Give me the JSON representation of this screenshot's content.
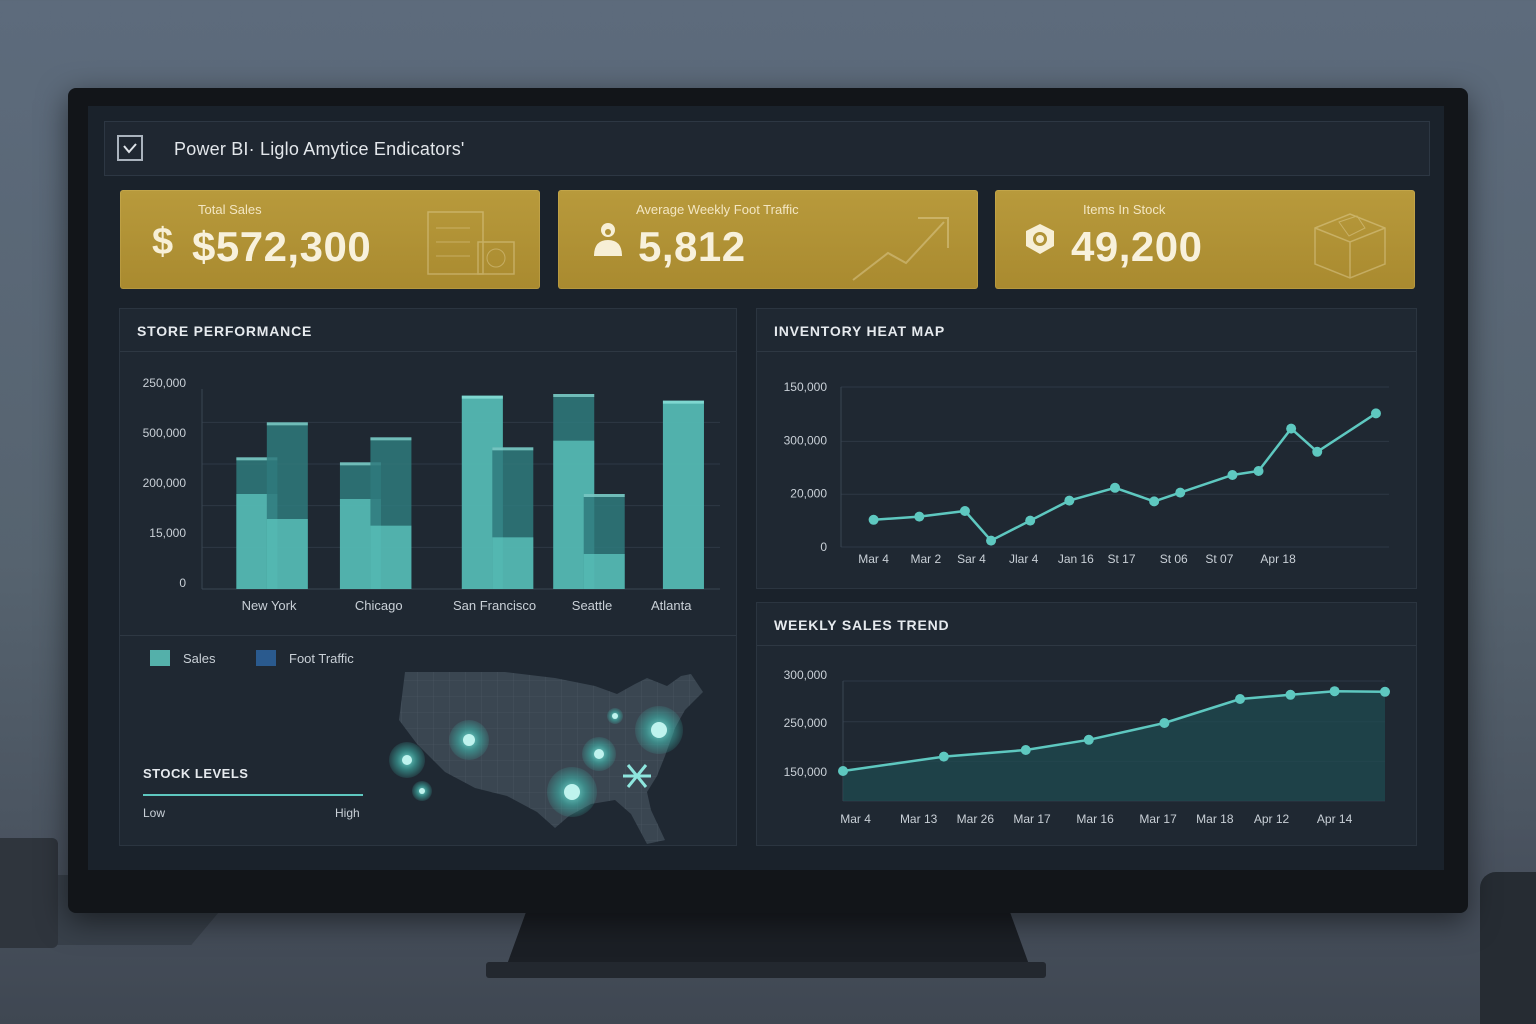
{
  "app": {
    "title": "Power BI· Liglo Amytice Endicators'"
  },
  "kpis": [
    {
      "label": "Total Sales",
      "value": "$572,300",
      "icon": "dollar-icon"
    },
    {
      "label": "Average Weekly Foot Traffic",
      "value": "5,812",
      "icon": "people-icon"
    },
    {
      "label": "Items In Stock",
      "value": "49,200",
      "icon": "stock-badge-icon"
    }
  ],
  "store_performance": {
    "title": "STORE PERFORMANCE",
    "legend": {
      "sales": "Sales",
      "foot_traffic": "Foot Traffic"
    },
    "stock_levels": {
      "title": "STOCK LEVELS",
      "low": "Low",
      "high": "High"
    }
  },
  "inventory_heat_map": {
    "title": "INVENTORY HEAT MAP"
  },
  "weekly_sales_trend": {
    "title": "WEEKLY SALES TREND"
  },
  "colors": {
    "accent": "#5ec8c0",
    "kpi_gold": "#b3953a",
    "panel": "#1f2832",
    "foot_traffic_legend": "#2a5a8e"
  },
  "chart_data": [
    {
      "type": "bar",
      "title": "STORE PERFORMANCE",
      "y_tick_labels": [
        "250,000",
        "500,000",
        "200,000",
        "15,000",
        "0"
      ],
      "categories": [
        "New York",
        "Chicago",
        "San Francisco",
        "Seattle",
        "Atlanta"
      ],
      "bars": [
        {
          "position": 0.9,
          "back": 0.79,
          "front": 0.57
        },
        {
          "position": 1.4,
          "back": 1.0,
          "front": 0.42
        },
        {
          "position": 2.6,
          "back": 0.76,
          "front": 0.54
        },
        {
          "position": 3.1,
          "back": 0.91,
          "front": 0.38
        },
        {
          "position": 4.6,
          "back": 1.16,
          "front": 1.16
        },
        {
          "position": 5.1,
          "back": 0.85,
          "front": 0.31
        },
        {
          "position": 6.1,
          "back": 1.17,
          "front": 0.89
        },
        {
          "position": 6.6,
          "back": 0.57,
          "front": 0.21
        },
        {
          "position": 7.9,
          "back": 1.13,
          "front": 1.13
        }
      ],
      "category_positions": [
        1.1,
        2.9,
        4.8,
        6.4,
        7.7
      ],
      "xlim": [
        0,
        8.5
      ],
      "legend": [
        "Sales",
        "Foot Traffic"
      ],
      "grid": true
    },
    {
      "type": "line",
      "title": "INVENTORY HEAT MAP",
      "y_tick_labels": [
        "150,000",
        "300,000",
        "20,000",
        "0"
      ],
      "x_tick_labels": [
        "Mar 4",
        "Mar 2",
        "Sar 4",
        "Jlar 4",
        "Jan 16",
        "St 17",
        "St 06",
        "St 07",
        "Apr 18"
      ],
      "x": [
        0.5,
        1.2,
        1.9,
        2.3,
        2.9,
        3.5,
        4.2,
        4.8,
        5.2,
        6.0,
        6.4,
        6.9,
        7.3,
        8.2
      ],
      "values": [
        0.34,
        0.38,
        0.45,
        0.08,
        0.33,
        0.58,
        0.74,
        0.57,
        0.68,
        0.9,
        0.95,
        1.48,
        1.19,
        1.67
      ],
      "x_tick_positions": [
        0.5,
        1.3,
        2.0,
        2.8,
        3.6,
        4.3,
        5.1,
        5.8,
        6.7
      ],
      "xlim": [
        0,
        8.4
      ],
      "ylim": [
        0,
        2
      ],
      "grid": true
    },
    {
      "type": "area",
      "title": "WEEKLY SALES TREND",
      "y_tick_labels": [
        "300,000",
        "250,000",
        "150,000"
      ],
      "x_tick_labels": [
        "Mar 4",
        "Mar 13",
        "Mar 26",
        "Mar 17",
        "Mar 16",
        "Mar 17",
        "Mar 18",
        "Apr 12",
        "Apr 14"
      ],
      "x": [
        0,
        1.6,
        2.9,
        3.9,
        5.1,
        6.3,
        7.1,
        7.8,
        8.6
      ],
      "values": [
        150000,
        174000,
        185000,
        202000,
        230000,
        270000,
        277000,
        283000,
        282000
      ],
      "x_tick_positions": [
        0.2,
        1.2,
        2.1,
        3.0,
        4.0,
        5.0,
        5.9,
        6.8,
        7.8
      ],
      "xlim": [
        0,
        8.6
      ],
      "ylim": [
        100000,
        300000
      ],
      "grid": true
    }
  ]
}
